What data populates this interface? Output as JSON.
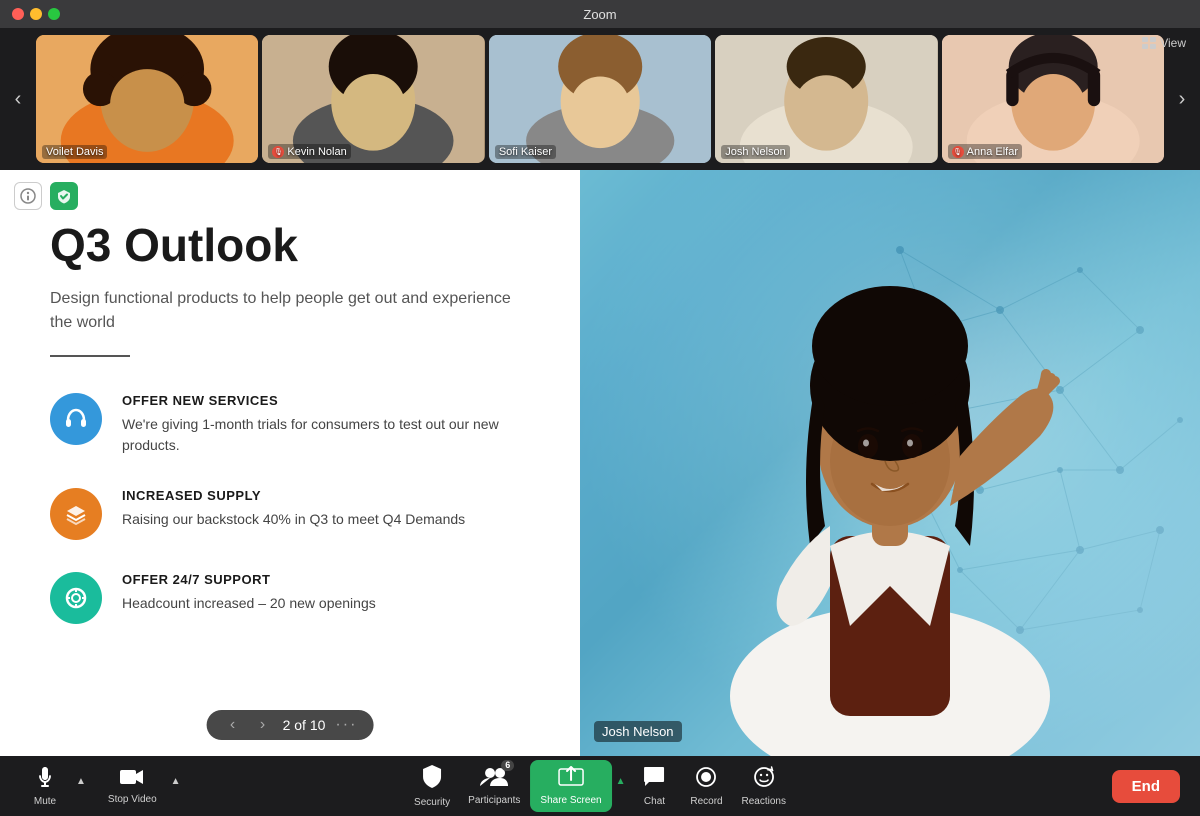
{
  "titleBar": {
    "title": "Zoom",
    "controls": [
      "close",
      "minimize",
      "maximize"
    ]
  },
  "participantStrip": {
    "prevLabel": "‹",
    "nextLabel": "›",
    "viewLabel": "View",
    "participants": [
      {
        "id": "voilet",
        "name": "Voilet Davis",
        "muted": false,
        "class": "p-voilet"
      },
      {
        "id": "kevin",
        "name": "Kevin Nolan",
        "muted": true,
        "class": "p-kevin"
      },
      {
        "id": "sofi",
        "name": "Sofi Kaiser",
        "muted": false,
        "class": "p-sofi"
      },
      {
        "id": "josh",
        "name": "Josh Nelson",
        "muted": false,
        "class": "p-josh"
      },
      {
        "id": "anna",
        "name": "Anna Elfar",
        "muted": true,
        "class": "p-anna"
      }
    ]
  },
  "slide": {
    "title": "Q3 Outlook",
    "subtitle": "Design functional products to help people get out and experience the world",
    "navCurrent": "2",
    "navTotal": "10",
    "navText": "2 of 10",
    "items": [
      {
        "id": "services",
        "heading": "OFFER NEW SERVICES",
        "description": "We're giving 1-month trials for consumers to test out our new products.",
        "iconColor": "icon-blue",
        "iconSymbol": "🎧"
      },
      {
        "id": "supply",
        "heading": "INCREASED SUPPLY",
        "description": "Raising our backstock 40% in Q3 to meet Q4 Demands",
        "iconColor": "icon-orange",
        "iconSymbol": "⊞"
      },
      {
        "id": "support",
        "heading": "OFFER 24/7 SUPPORT",
        "description": "Headcount increased – 20 new openings",
        "iconColor": "icon-teal",
        "iconSymbol": "◎"
      }
    ]
  },
  "presenter": {
    "name": "Josh Nelson"
  },
  "toolbar": {
    "mute": {
      "label": "Mute",
      "icon": "🎙"
    },
    "stopVideo": {
      "label": "Stop Video",
      "icon": "🎥"
    },
    "security": {
      "label": "Security",
      "icon": "🛡"
    },
    "participants": {
      "label": "Participants",
      "icon": "👥",
      "count": "6"
    },
    "shareScreen": {
      "label": "Share Screen",
      "icon": "↑"
    },
    "chat": {
      "label": "Chat",
      "icon": "💬"
    },
    "record": {
      "label": "Record",
      "icon": "⏺"
    },
    "reactions": {
      "label": "Reactions",
      "icon": "😊"
    },
    "end": {
      "label": "End"
    }
  },
  "colors": {
    "toolbarBg": "#1c1c1e",
    "shareGreen": "#27ae60",
    "endRed": "#e74c3c",
    "stripBg": "#1c1c1e"
  }
}
